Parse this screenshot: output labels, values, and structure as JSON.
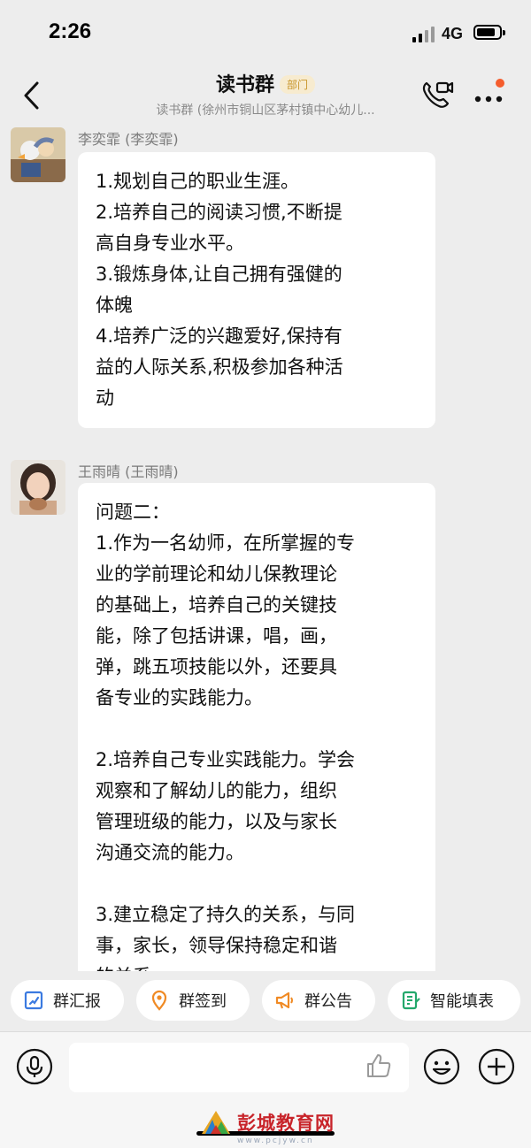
{
  "status_bar": {
    "time": "2:26",
    "network": "4G"
  },
  "header": {
    "title": "读书群",
    "badge": "部门",
    "subtitle": "读书群 (徐州市铜山区茅村镇中心幼儿..."
  },
  "messages": [
    {
      "sender": "李奕霏 (李奕霏)",
      "text": "1.规划自己的职业生涯。\n2.培养自己的阅读习惯,不断提\n高自身专业水平。\n3.锻炼身体,让自己拥有强健的\n体魄\n4.培养广泛的兴趣爱好,保持有\n益的人际关系,积极参加各种活\n动"
    },
    {
      "sender": "王雨晴 (王雨晴)",
      "text": "问题二：\n1.作为一名幼师，在所掌握的专\n业的学前理论和幼儿保教理论\n的基础上，培养自己的关键技\n能，除了包括讲课，唱，画，\n弹，跳五项技能以外，还要具\n备专业的实践能力。\n\n2.培养自己专业实践能力。学会\n观察和了解幼儿的能力，组织\n管理班级的能力，以及与家长\n沟通交流的能力。\n\n3.建立稳定了持久的关系，与同\n事，家长，领导保持稳定和谐\n的关系。"
    }
  ],
  "quick_actions": [
    {
      "label": "群汇报",
      "icon": "report-icon",
      "color": "#3b7ae0"
    },
    {
      "label": "群签到",
      "icon": "location-icon",
      "color": "#f08a24"
    },
    {
      "label": "群公告",
      "icon": "megaphone-icon",
      "color": "#f08a24"
    },
    {
      "label": "智能填表",
      "icon": "form-icon",
      "color": "#23a86b"
    }
  ],
  "watermark": {
    "text": "彭城教育网",
    "url": "www.pcjyw.cn"
  },
  "colors": {
    "background": "#ededed",
    "bubble": "#ffffff",
    "badge": "#c8962b",
    "notify_dot": "#f55d2d"
  }
}
